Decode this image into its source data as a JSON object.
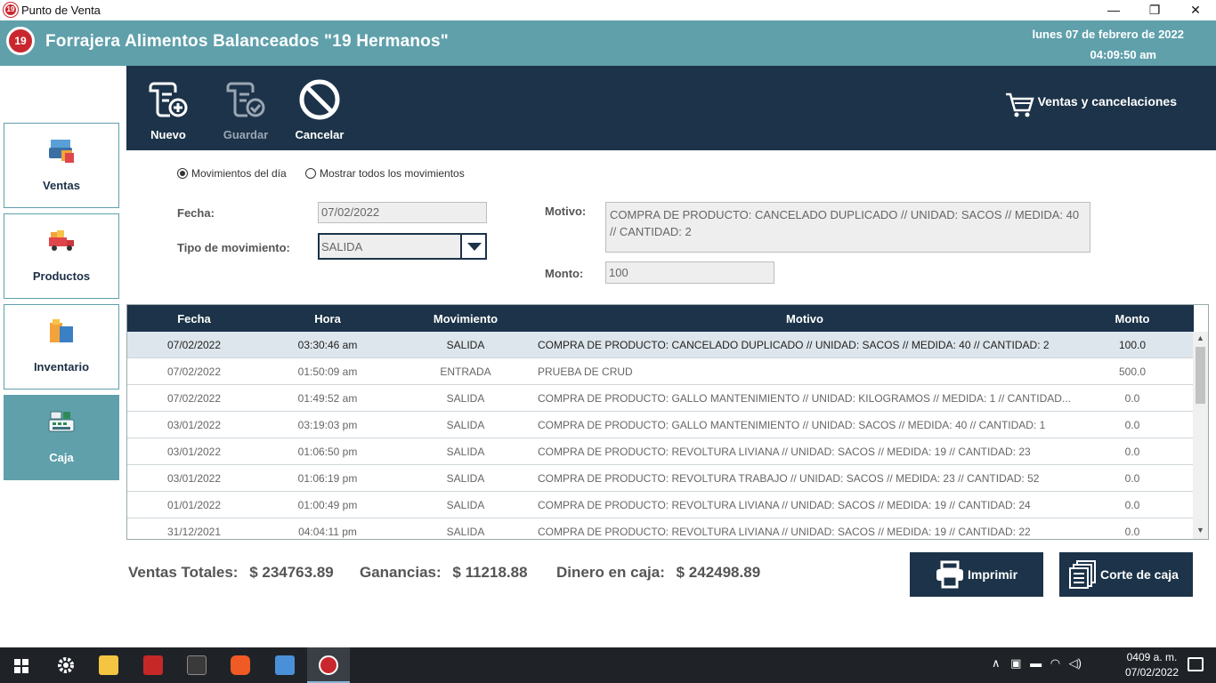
{
  "window": {
    "title": "Punto de Venta",
    "minimize": "—",
    "restore": "❐",
    "close": "✕"
  },
  "header": {
    "logo_text": "19",
    "company": "Forrajera Alimentos Balanceados \"19 Hermanos\"",
    "date": "lunes 07 de febrero de 2022",
    "time": "04:09:50 am"
  },
  "sidebar": {
    "items": [
      {
        "label": "Ventas",
        "icon": "cash-register-icon"
      },
      {
        "label": "Productos",
        "icon": "delivery-truck-icon"
      },
      {
        "label": "Inventario",
        "icon": "boxes-icon"
      },
      {
        "label": "Caja",
        "icon": "register-icon",
        "active": true
      }
    ]
  },
  "toolbar": {
    "nuevo": "Nuevo",
    "guardar": "Guardar",
    "cancelar": "Cancelar",
    "ventas_link": "Ventas y cancelaciones"
  },
  "filters": {
    "radio_dia": "Movimientos del día",
    "radio_todos": "Mostrar todos los movimientos",
    "selected": "radio_dia"
  },
  "form": {
    "fecha_label": "Fecha:",
    "fecha_value": "07/02/2022",
    "tipo_label": "Tipo de movimiento:",
    "tipo_value": "SALIDA",
    "motivo_label": "Motivo:",
    "motivo_value": "COMPRA DE PRODUCTO: CANCELADO DUPLICADO // UNIDAD: SACOS // MEDIDA: 40 // CANTIDAD: 2",
    "monto_label": "Monto:",
    "monto_value": "100"
  },
  "grid": {
    "columns": [
      "Fecha",
      "Hora",
      "Movimiento",
      "Motivo",
      "Monto"
    ],
    "rows": [
      {
        "fecha": "07/02/2022",
        "hora": "03:30:46 am",
        "mov": "SALIDA",
        "motivo": "COMPRA DE PRODUCTO: CANCELADO DUPLICADO // UNIDAD: SACOS // MEDIDA: 40 // CANTIDAD: 2",
        "monto": "100.0"
      },
      {
        "fecha": "07/02/2022",
        "hora": "01:50:09 am",
        "mov": "ENTRADA",
        "motivo": "PRUEBA DE CRUD",
        "monto": "500.0"
      },
      {
        "fecha": "07/02/2022",
        "hora": "01:49:52 am",
        "mov": "SALIDA",
        "motivo": "COMPRA DE PRODUCTO: GALLO MANTENIMIENTO // UNIDAD: KILOGRAMOS // MEDIDA: 1 // CANTIDAD...",
        "monto": "0.0"
      },
      {
        "fecha": "03/01/2022",
        "hora": "03:19:03 pm",
        "mov": "SALIDA",
        "motivo": "COMPRA DE PRODUCTO: GALLO MANTENIMIENTO // UNIDAD: SACOS // MEDIDA: 40 // CANTIDAD: 1",
        "monto": "0.0"
      },
      {
        "fecha": "03/01/2022",
        "hora": "01:06:50 pm",
        "mov": "SALIDA",
        "motivo": "COMPRA DE PRODUCTO: REVOLTURA LIVIANA // UNIDAD: SACOS // MEDIDA: 19 // CANTIDAD: 23",
        "monto": "0.0"
      },
      {
        "fecha": "03/01/2022",
        "hora": "01:06:19 pm",
        "mov": "SALIDA",
        "motivo": "COMPRA DE PRODUCTO: REVOLTURA TRABAJO // UNIDAD: SACOS // MEDIDA: 23 // CANTIDAD: 52",
        "monto": "0.0"
      },
      {
        "fecha": "01/01/2022",
        "hora": "01:00:49 pm",
        "mov": "SALIDA",
        "motivo": "COMPRA DE PRODUCTO: REVOLTURA LIVIANA // UNIDAD: SACOS // MEDIDA: 19 // CANTIDAD: 24",
        "monto": "0.0"
      },
      {
        "fecha": "31/12/2021",
        "hora": "04:04:11 pm",
        "mov": "SALIDA",
        "motivo": "COMPRA DE PRODUCTO: REVOLTURA LIVIANA // UNIDAD: SACOS // MEDIDA: 19 // CANTIDAD: 22",
        "monto": "0.0"
      }
    ]
  },
  "totals": {
    "ventas_label": "Ventas Totales:",
    "ventas_value": "$ 234763.89",
    "ganancias_label": "Ganancias:",
    "ganancias_value": "$ 11218.88",
    "dinero_label": "Dinero en caja:",
    "dinero_value": "$ 242498.89"
  },
  "actions": {
    "imprimir": "Imprimir",
    "corte": "Corte de caja"
  },
  "taskbar": {
    "time": "04​09 a. m.",
    "date": "07/02/2022"
  },
  "colors": {
    "teal": "#5fa0ab",
    "navy": "#1c3349",
    "logo_red": "#c9272e"
  }
}
